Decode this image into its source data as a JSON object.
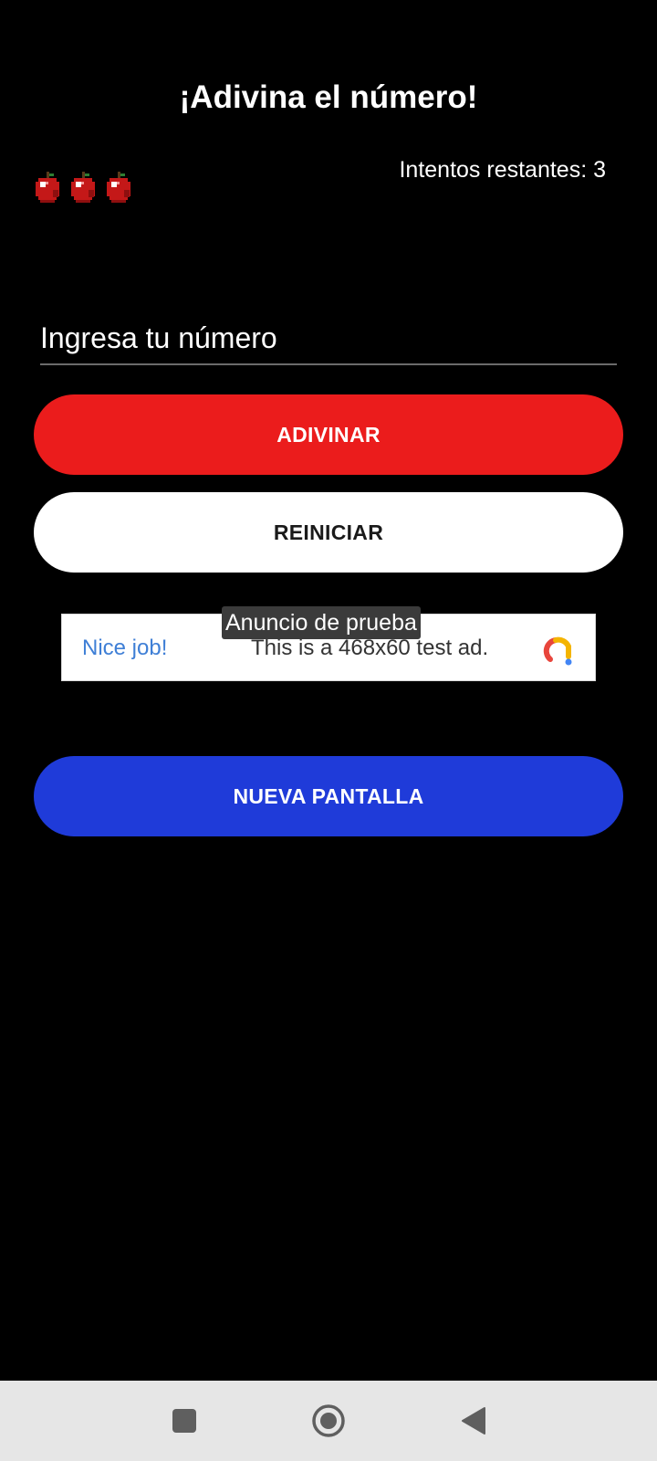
{
  "header": {
    "title": "¡Adivina el número!",
    "attempts_text": "Intentos restantes: 3"
  },
  "lives": {
    "icon": "apple-icon",
    "count": 3
  },
  "guess_input": {
    "placeholder": "Ingresa tu número",
    "value": ""
  },
  "buttons": {
    "guess_label": "ADIVINAR",
    "reset_label": "REINICIAR",
    "new_screen_label": "NUEVA PANTALLA"
  },
  "ad": {
    "label": "Anuncio de prueba",
    "headline": "Nice job!",
    "body": "This is a 468x60 test ad.",
    "logo_icon": "ad-logo-icon"
  },
  "nav_bar": {
    "recents_icon": "square-icon",
    "home_icon": "home-circle-icon",
    "back_icon": "triangle-back-icon"
  },
  "colors": {
    "background": "#000000",
    "guess_button": "#eb1c1c",
    "reset_button": "#ffffff",
    "new_screen_button": "#1f3bd9",
    "ad_headline": "#3f7fd6",
    "nav_bar": "#e6e6e6"
  }
}
